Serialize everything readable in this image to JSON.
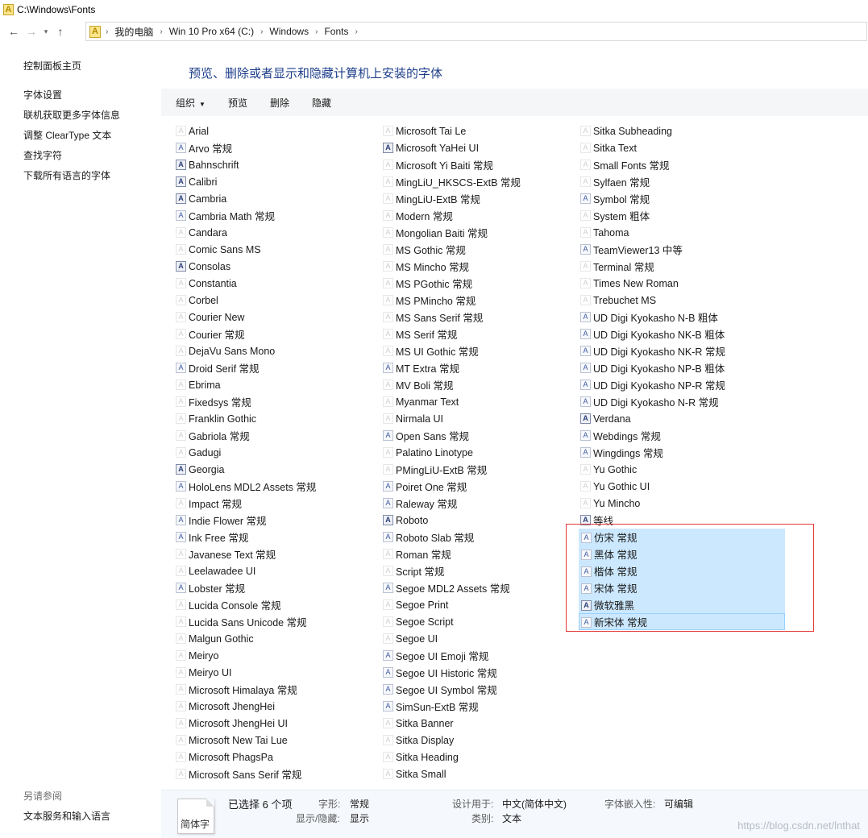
{
  "window": {
    "title": "C:\\Windows\\Fonts"
  },
  "address": {
    "crumbs": [
      "我的电脑",
      "Win 10 Pro x64 (C:)",
      "Windows",
      "Fonts"
    ]
  },
  "left": {
    "links": [
      "控制面板主页",
      "字体设置",
      "联机获取更多字体信息",
      "调整 ClearType 文本",
      "查找字符",
      "下载所有语言的字体"
    ],
    "see_also_heading": "另请参阅",
    "see_also_links": [
      "文本服务和输入语言"
    ]
  },
  "main": {
    "heading": "预览、删除或者显示和隐藏计算机上安装的字体",
    "toolbar": {
      "organize": "组织",
      "preview": "预览",
      "delete": "删除",
      "hide": "隐藏"
    },
    "columns": [
      [
        {
          "name": "Arial",
          "icon": "plain"
        },
        {
          "name": "Arvo 常规",
          "icon": "tt"
        },
        {
          "name": "Bahnschrift",
          "icon": "bold"
        },
        {
          "name": "Calibri",
          "icon": "bold"
        },
        {
          "name": "Cambria",
          "icon": "bold"
        },
        {
          "name": "Cambria Math 常规",
          "icon": "tt"
        },
        {
          "name": "Candara",
          "icon": "plain"
        },
        {
          "name": "Comic Sans MS",
          "icon": "plain"
        },
        {
          "name": "Consolas",
          "icon": "bold"
        },
        {
          "name": "Constantia",
          "icon": "plain"
        },
        {
          "name": "Corbel",
          "icon": "plain"
        },
        {
          "name": "Courier New",
          "icon": "plain"
        },
        {
          "name": "Courier 常规",
          "icon": "plain"
        },
        {
          "name": "DejaVu Sans Mono",
          "icon": "plain"
        },
        {
          "name": "Droid Serif 常规",
          "icon": "tt"
        },
        {
          "name": "Ebrima",
          "icon": "plain"
        },
        {
          "name": "Fixedsys 常规",
          "icon": "plain"
        },
        {
          "name": "Franklin Gothic",
          "icon": "plain"
        },
        {
          "name": "Gabriola 常规",
          "icon": "plain"
        },
        {
          "name": "Gadugi",
          "icon": "plain"
        },
        {
          "name": "Georgia",
          "icon": "bold"
        },
        {
          "name": "HoloLens MDL2 Assets 常规",
          "icon": "tt"
        },
        {
          "name": "Impact 常规",
          "icon": "plain"
        },
        {
          "name": "Indie Flower 常规",
          "icon": "tt"
        },
        {
          "name": "Ink Free 常规",
          "icon": "tt"
        },
        {
          "name": "Javanese Text 常规",
          "icon": "plain"
        },
        {
          "name": "Leelawadee UI",
          "icon": "plain"
        },
        {
          "name": "Lobster 常规",
          "icon": "tt"
        },
        {
          "name": "Lucida Console 常规",
          "icon": "plain"
        },
        {
          "name": "Lucida Sans Unicode 常规",
          "icon": "plain"
        },
        {
          "name": "Malgun Gothic",
          "icon": "plain"
        },
        {
          "name": "Meiryo",
          "icon": "plain"
        },
        {
          "name": "Meiryo UI",
          "icon": "plain"
        },
        {
          "name": "Microsoft Himalaya 常规",
          "icon": "plain"
        },
        {
          "name": "Microsoft JhengHei",
          "icon": "plain"
        },
        {
          "name": "Microsoft JhengHei UI",
          "icon": "plain"
        },
        {
          "name": "Microsoft New Tai Lue",
          "icon": "plain"
        },
        {
          "name": "Microsoft PhagsPa",
          "icon": "plain"
        },
        {
          "name": "Microsoft Sans Serif 常规",
          "icon": "plain"
        }
      ],
      [
        {
          "name": "Microsoft Tai Le",
          "icon": "plain"
        },
        {
          "name": "Microsoft YaHei UI",
          "icon": "bold"
        },
        {
          "name": "Microsoft Yi Baiti 常规",
          "icon": "plain"
        },
        {
          "name": "MingLiU_HKSCS-ExtB 常规",
          "icon": "plain"
        },
        {
          "name": "MingLiU-ExtB 常规",
          "icon": "plain"
        },
        {
          "name": "Modern 常规",
          "icon": "plain"
        },
        {
          "name": "Mongolian Baiti 常规",
          "icon": "plain"
        },
        {
          "name": "MS Gothic 常规",
          "icon": "plain"
        },
        {
          "name": "MS Mincho 常规",
          "icon": "plain"
        },
        {
          "name": "MS PGothic 常规",
          "icon": "plain"
        },
        {
          "name": "MS PMincho 常规",
          "icon": "plain"
        },
        {
          "name": "MS Sans Serif 常规",
          "icon": "plain"
        },
        {
          "name": "MS Serif 常规",
          "icon": "plain"
        },
        {
          "name": "MS UI Gothic 常规",
          "icon": "plain"
        },
        {
          "name": "MT Extra 常规",
          "icon": "tt"
        },
        {
          "name": "MV Boli 常规",
          "icon": "plain"
        },
        {
          "name": "Myanmar Text",
          "icon": "plain"
        },
        {
          "name": "Nirmala UI",
          "icon": "plain"
        },
        {
          "name": "Open Sans 常规",
          "icon": "tt"
        },
        {
          "name": "Palatino Linotype",
          "icon": "plain"
        },
        {
          "name": "PMingLiU-ExtB 常规",
          "icon": "plain"
        },
        {
          "name": "Poiret One 常规",
          "icon": "tt"
        },
        {
          "name": "Raleway 常规",
          "icon": "tt"
        },
        {
          "name": "Roboto",
          "icon": "bold"
        },
        {
          "name": "Roboto Slab 常规",
          "icon": "tt"
        },
        {
          "name": "Roman 常规",
          "icon": "plain"
        },
        {
          "name": "Script 常规",
          "icon": "plain"
        },
        {
          "name": "Segoe MDL2 Assets 常规",
          "icon": "tt"
        },
        {
          "name": "Segoe Print",
          "icon": "plain"
        },
        {
          "name": "Segoe Script",
          "icon": "plain"
        },
        {
          "name": "Segoe UI",
          "icon": "plain"
        },
        {
          "name": "Segoe UI Emoji 常规",
          "icon": "tt"
        },
        {
          "name": "Segoe UI Historic 常规",
          "icon": "tt"
        },
        {
          "name": "Segoe UI Symbol 常规",
          "icon": "tt"
        },
        {
          "name": "SimSun-ExtB 常规",
          "icon": "tt"
        },
        {
          "name": "Sitka Banner",
          "icon": "plain"
        },
        {
          "name": "Sitka Display",
          "icon": "plain"
        },
        {
          "name": "Sitka Heading",
          "icon": "plain"
        },
        {
          "name": "Sitka Small",
          "icon": "plain"
        }
      ],
      [
        {
          "name": "Sitka Subheading",
          "icon": "plain"
        },
        {
          "name": "Sitka Text",
          "icon": "plain"
        },
        {
          "name": "Small Fonts 常规",
          "icon": "plain"
        },
        {
          "name": "Sylfaen 常规",
          "icon": "plain"
        },
        {
          "name": "Symbol 常规",
          "icon": "tt"
        },
        {
          "name": "System 粗体",
          "icon": "plain"
        },
        {
          "name": "Tahoma",
          "icon": "plain"
        },
        {
          "name": "TeamViewer13 中等",
          "icon": "tt"
        },
        {
          "name": "Terminal 常规",
          "icon": "plain"
        },
        {
          "name": "Times New Roman",
          "icon": "plain"
        },
        {
          "name": "Trebuchet MS",
          "icon": "plain"
        },
        {
          "name": "UD Digi Kyokasho N-B 粗体",
          "icon": "tt"
        },
        {
          "name": "UD Digi Kyokasho NK-B 粗体",
          "icon": "tt"
        },
        {
          "name": "UD Digi Kyokasho NK-R 常规",
          "icon": "tt"
        },
        {
          "name": "UD Digi Kyokasho NP-B 粗体",
          "icon": "tt"
        },
        {
          "name": "UD Digi Kyokasho NP-R 常规",
          "icon": "tt"
        },
        {
          "name": "UD Digi Kyokasho N-R 常规",
          "icon": "tt"
        },
        {
          "name": "Verdana",
          "icon": "bold"
        },
        {
          "name": "Webdings 常规",
          "icon": "tt"
        },
        {
          "name": "Wingdings 常规",
          "icon": "tt"
        },
        {
          "name": "Yu Gothic",
          "icon": "plain"
        },
        {
          "name": "Yu Gothic UI",
          "icon": "plain"
        },
        {
          "name": "Yu Mincho",
          "icon": "plain"
        },
        {
          "name": "等线",
          "icon": "bold"
        },
        {
          "name": "仿宋 常规",
          "icon": "tt",
          "selected": true
        },
        {
          "name": "黑体 常规",
          "icon": "tt",
          "selected": true
        },
        {
          "name": "楷体 常规",
          "icon": "tt",
          "selected": true
        },
        {
          "name": "宋体 常规",
          "icon": "tt",
          "selected": true
        },
        {
          "name": "微软雅黑",
          "icon": "bold",
          "selected": true
        },
        {
          "name": "新宋体 常规",
          "icon": "tt",
          "selected": true,
          "focused": true
        }
      ]
    ]
  },
  "details": {
    "thumbnail_text": "简体字",
    "selection": "已选择 6 个项",
    "style_label": "字形:",
    "style_value": "常规",
    "visibility_label": "显示/隐藏:",
    "visibility_value": "显示",
    "designed_for_label": "设计用于:",
    "designed_for_value": "中文(简体中文)",
    "category_label": "类别:",
    "category_value": "文本",
    "embed_label": "字体嵌入性:",
    "embed_value": "可编辑"
  },
  "watermark": "https://blog.csdn.net/lnthat",
  "colors": {
    "selection": "#cce8ff",
    "highlight_border": "#e43a3a",
    "heading": "#1e3f8b"
  }
}
